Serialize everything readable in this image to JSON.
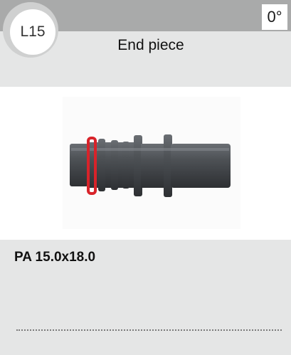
{
  "badge": {
    "code": "L15"
  },
  "header": {
    "angle": "0°",
    "title": "End piece"
  },
  "product": {
    "image_icon": "end-piece-connector-icon",
    "spec": "PA 15.0x18.0"
  },
  "colors": {
    "top_band": "#a9aaaa",
    "panel": "#e5e6e6",
    "part_body": "#4a4d51",
    "o_ring": "#d8232a"
  }
}
